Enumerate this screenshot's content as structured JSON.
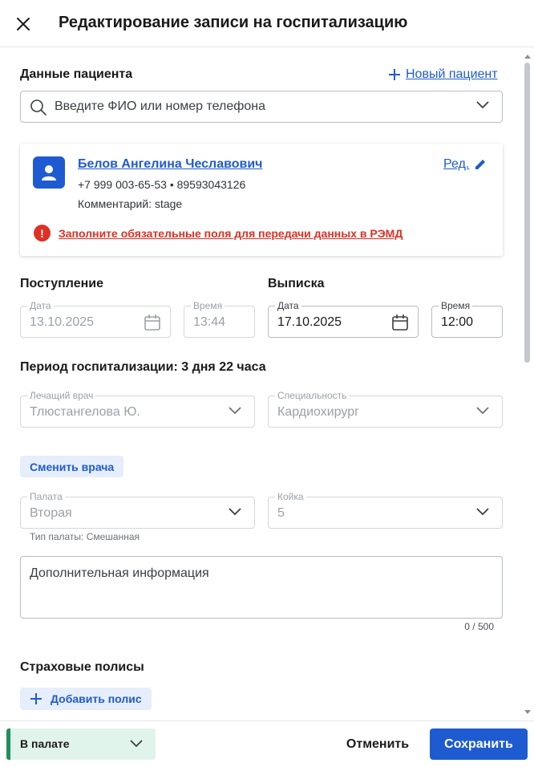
{
  "header": {
    "title": "Редактирование записи на госпитализацию"
  },
  "patient": {
    "section_title": "Данные пациента",
    "new_patient_label": "Новый пациент",
    "search_placeholder": "Введите ФИО или номер телефона",
    "name": "Белов Ангелина Чеславович",
    "phones": "+7 999 003-65-53 • 89593043126",
    "comment": "Комментарий: stage",
    "edit_label": "Ред.",
    "warning": "Заполните обязательные поля для передачи данных в РЭМД"
  },
  "admission": {
    "title": "Поступление",
    "date_label": "Дата",
    "date_value": "13.10.2025",
    "time_label": "Время",
    "time_value": "13:44"
  },
  "discharge": {
    "title": "Выписка",
    "date_label": "Дата",
    "date_value": "17.10.2025",
    "time_label": "Время",
    "time_value": "12:00"
  },
  "period": "Период госпитализации: 3 дня 22 часа",
  "doctor": {
    "label": "Лечащий врач",
    "value": "Тлюстангелова Ю.",
    "specialty_label": "Специальность",
    "specialty_value": "Кардиохирург",
    "change_label": "Сменить врача"
  },
  "ward": {
    "label": "Палата",
    "value": "Вторая",
    "bed_label": "Койка",
    "bed_value": "5",
    "type_text": "Тип палаты: Смешанная"
  },
  "additional": {
    "placeholder": "Дополнительная информация",
    "counter": "0 / 500"
  },
  "insurance": {
    "title": "Страховые полисы",
    "add_label": "Добавить полис"
  },
  "footer": {
    "status_value": "В палате",
    "cancel_label": "Отменить",
    "save_label": "Сохранить"
  },
  "colors": {
    "accent": "#1f5bd0",
    "error": "#e03024",
    "status_bg": "#e1f4ec",
    "status_bar": "#1f8f5e"
  }
}
